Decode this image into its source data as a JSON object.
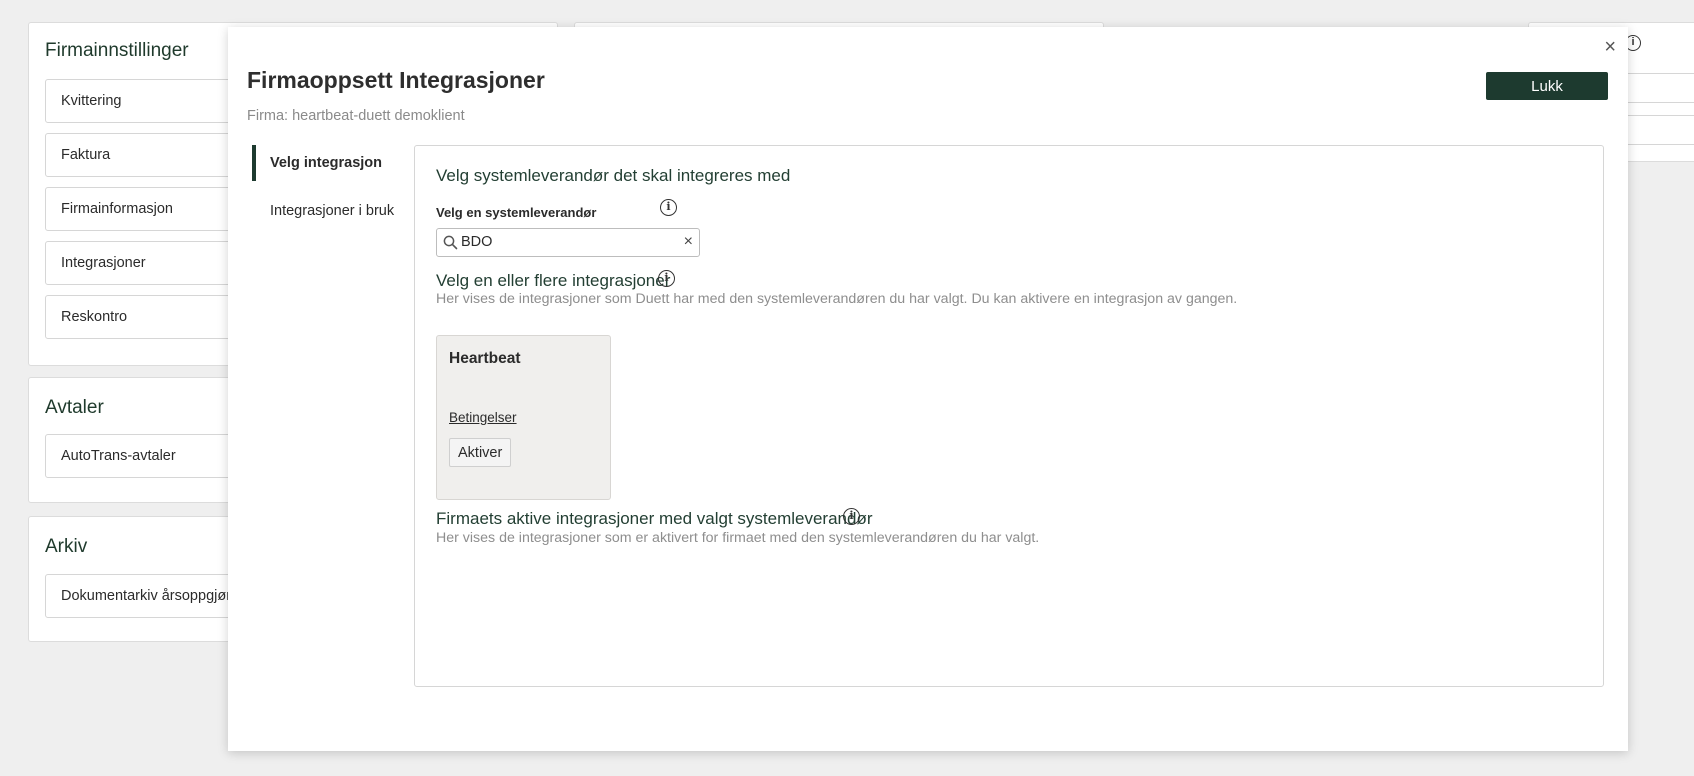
{
  "background": {
    "firmainnstillinger": {
      "title": "Firmainnstillinger",
      "items": [
        "Kvittering",
        "Faktura",
        "Firmainformasjon",
        "Integrasjoner",
        "Reskontro"
      ]
    },
    "avtaler": {
      "title": "Avtaler",
      "items": [
        "AutoTrans-avtaler"
      ]
    },
    "arkiv": {
      "title": "Arkiv",
      "items": [
        "Dokumentarkiv årsoppgjør"
      ]
    }
  },
  "modal": {
    "title": "Firmaoppsett Integrasjoner",
    "subtitle": "Firma: heartbeat-duett demoklient",
    "close_label": "Lukk",
    "close_icon": "×",
    "nav": [
      {
        "label": "Velg integrasjon",
        "active": true
      },
      {
        "label": "Integrasjoner i bruk",
        "active": false
      }
    ],
    "section_supplier": {
      "heading": "Velg systemleverandør det skal integreres med",
      "field_label": "Velg en systemleverandør",
      "search_value": "BDO",
      "clear_icon": "×"
    },
    "section_integrations": {
      "heading": "Velg en eller flere integrasjoner",
      "description": "Her vises de integrasjoner som Duett har med den systemleverandøren du har valgt. Du kan aktivere en integrasjon av gangen.",
      "cards": [
        {
          "title": "Heartbeat",
          "link": "Betingelser",
          "button": "Aktiver"
        }
      ]
    },
    "section_active": {
      "heading": "Firmaets aktive integrasjoner med valgt systemleverandør",
      "description": "Her vises de integrasjoner som er aktivert for firmaet med den systemleverandøren du har valgt."
    }
  },
  "colors": {
    "brand_dark_green": "#1d3a2f",
    "heading_green": "#233f33",
    "muted_text": "#8e8e8e"
  }
}
